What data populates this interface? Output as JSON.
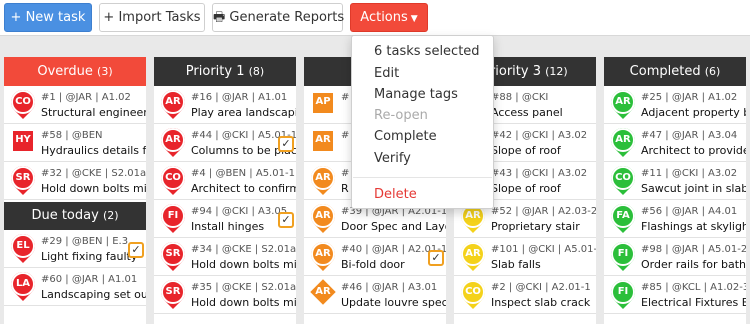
{
  "toolbar": {
    "new_task": "+ New task",
    "import_tasks": "Import Tasks",
    "generate_reports": "Generate Reports",
    "actions": "Actions"
  },
  "menu": {
    "selected": "6 tasks selected",
    "edit": "Edit",
    "manage_tags": "Manage tags",
    "reopen": "Re-open",
    "complete": "Complete",
    "verify": "Verify",
    "delete": "Delete"
  },
  "colors": {
    "overdue": "#f24a3a",
    "priority": "#333333",
    "red_pin": "#e8242b",
    "orange": "#f28a1e",
    "yellow": "#f4d21a",
    "green": "#2bbf3a",
    "accent": "#4a90e2"
  },
  "columns": {
    "overdue": {
      "label": "Overdue",
      "count": "(3)",
      "cards": [
        {
          "badge": "CO",
          "meta": "#1 | @JAR | A1.02",
          "title": "Structural engineer to",
          "shape": "pin",
          "color": "#e8242b"
        },
        {
          "badge": "HY",
          "meta": "#58 | @BEN",
          "title": "Hydraulics details for",
          "shape": "square",
          "color": "#e8242b"
        },
        {
          "badge": "SR",
          "meta": "#32 | @CKE | S2.01a",
          "title": "Hold down bolts missi",
          "shape": "pin",
          "color": "#e8242b"
        }
      ],
      "sub": {
        "label": "Due today",
        "count": "(2)"
      },
      "sub_cards": [
        {
          "badge": "EL",
          "meta": "#29 | @BEN | E.3",
          "title": "Light fixing faulty",
          "shape": "pin",
          "color": "#e8242b",
          "checked": "✓"
        },
        {
          "badge": "LA",
          "meta": "#60 | @JAR | A1.01",
          "title": "Landscaping set out to",
          "shape": "pin",
          "color": "#e8242b"
        }
      ]
    },
    "p1": {
      "label": "Priority 1",
      "count": "(8)",
      "cards": [
        {
          "badge": "AR",
          "meta": "#16 | @JAR | A1.01",
          "title": "Play area landscaping",
          "shape": "pin",
          "color": "#e8242b"
        },
        {
          "badge": "AR",
          "meta": "#44 | @CKI | A5.01-1",
          "title": "Columns to be placed",
          "shape": "pin",
          "color": "#e8242b",
          "checked": "✓"
        },
        {
          "badge": "CO",
          "meta": "#4 | @BEN | A5.01-1",
          "title": "Architect to confirm g",
          "shape": "pin",
          "color": "#e8242b"
        },
        {
          "badge": "FI",
          "meta": "#94 | @CKI | A3.05",
          "title": "Install hinges",
          "shape": "pin",
          "color": "#e8242b",
          "checked": "✓"
        },
        {
          "badge": "SR",
          "meta": "#34 | @CKE | S2.01a",
          "title": "Hold down bolts missi",
          "shape": "pin",
          "color": "#e8242b"
        },
        {
          "badge": "SR",
          "meta": "#35 | @CKE | S2.01a",
          "title": "Hold down bolts missi",
          "shape": "pin",
          "color": "#e8242b"
        }
      ]
    },
    "p2": {
      "label": "Pr",
      "cards": [
        {
          "badge": "AP",
          "meta": "#",
          "title": "",
          "shape": "square",
          "color": "#f28a1e"
        },
        {
          "badge": "AR",
          "meta": "#",
          "title": "",
          "shape": "square",
          "color": "#f28a1e"
        },
        {
          "badge": "AR",
          "meta": "#",
          "title": "R",
          "shape": "pin",
          "color": "#f28a1e"
        },
        {
          "badge": "AR",
          "meta": "#39 | @JAR | A2.01-1",
          "title": "Door Spec and Layout",
          "shape": "pin",
          "color": "#f28a1e"
        },
        {
          "badge": "AR",
          "meta": "#40 | @JAR | A2.01-1",
          "title": "Bi-fold door",
          "shape": "pin",
          "color": "#f28a1e",
          "checked": "✓"
        },
        {
          "badge": "AR",
          "meta": "#46 | @JAR | A3.01",
          "title": "Update louvre spec",
          "shape": "diamond",
          "color": "#f28a1e"
        }
      ]
    },
    "p3": {
      "label": "Priority 3",
      "count": "(12)",
      "cards": [
        {
          "badge": "",
          "meta": "#88 | @CKI",
          "title": "Access panel",
          "shape": "none",
          "color": "#f4d21a"
        },
        {
          "badge": "",
          "meta": "#42 | @CKI | A3.02",
          "title": "Slope of roof",
          "shape": "none",
          "color": "#f4d21a"
        },
        {
          "badge": "",
          "meta": "#43 | @CKI | A3.02",
          "title": "Slope of roof",
          "shape": "none",
          "color": "#f4d21a"
        },
        {
          "badge": "AR",
          "meta": "#52 | @JAR | A2.03-2",
          "title": "Proprietary stair",
          "shape": "pin",
          "color": "#f4d21a"
        },
        {
          "badge": "AR",
          "meta": "#101 | @CKI | A5.01-1",
          "title": "Slab falls",
          "shape": "pin",
          "color": "#f4d21a"
        },
        {
          "badge": "CO",
          "meta": "#2 | @CKI | A2.01-1",
          "title": "Inspect slab crack",
          "shape": "pin",
          "color": "#f4d21a"
        }
      ]
    },
    "done": {
      "label": "Completed",
      "count": "(6)",
      "cards": [
        {
          "badge": "AR",
          "meta": "#25 | @JAR | A1.02",
          "title": "Adjacent property boo",
          "shape": "pin",
          "color": "#2bbf3a"
        },
        {
          "badge": "AR",
          "meta": "#47 | @JAR | A3.04",
          "title": "Architect to provide fi",
          "shape": "pin",
          "color": "#2bbf3a"
        },
        {
          "badge": "CO",
          "meta": "#11 | @CKI | A3.02",
          "title": "Sawcut joint in slab",
          "shape": "pin",
          "color": "#2bbf3a"
        },
        {
          "badge": "FA",
          "meta": "#56 | @JAR | A4.01",
          "title": "Flashings at skylight",
          "shape": "pin",
          "color": "#2bbf3a"
        },
        {
          "badge": "FI",
          "meta": "#98 | @JAR | A5.01-2",
          "title": "Order rails for bathro",
          "shape": "pin",
          "color": "#2bbf3a"
        },
        {
          "badge": "FI",
          "meta": "#85 | @KCL | A1.02-3",
          "title": "Electrical Fixtures Bro",
          "shape": "pin",
          "color": "#2bbf3a"
        }
      ]
    }
  }
}
